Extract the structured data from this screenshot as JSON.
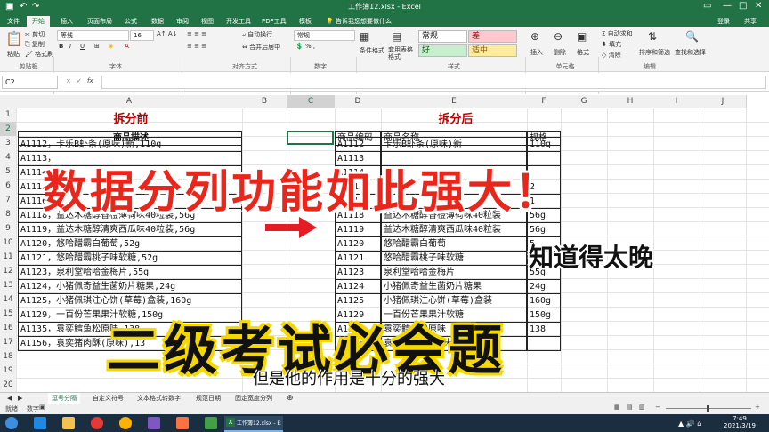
{
  "window": {
    "title": "工作簿12.xlsx - Excel",
    "login": "登录",
    "share": "共享",
    "tell_me": "告诉我您想要做什么"
  },
  "ribbon_tabs": [
    "文件",
    "开始",
    "插入",
    "页面布局",
    "公式",
    "数据",
    "审阅",
    "视图",
    "开发工具",
    "PDF工具",
    "模板"
  ],
  "ribbon": {
    "clipboard": {
      "label": "剪贴板",
      "paste": "粘贴",
      "cut": "剪切",
      "copy": "复制",
      "format_painter": "格式刷"
    },
    "font": {
      "label": "字体",
      "name": "等线",
      "size": "16"
    },
    "alignment": {
      "label": "对齐方式",
      "wrap": "自动换行",
      "merge": "合并后居中"
    },
    "number": {
      "label": "数字",
      "format": "常规"
    },
    "styles": {
      "conditional": "条件格式",
      "table": "套用表格格式",
      "normal": "常规",
      "bad": "差",
      "good": "好",
      "neutral": "适中",
      "label": "样式"
    },
    "cells": {
      "insert": "插入",
      "delete": "删除",
      "format": "格式",
      "label": "单元格"
    },
    "editing": {
      "autosum": "自动求和",
      "fill": "填充",
      "clear": "清除",
      "sort": "排序和筛选",
      "find": "查找和选择",
      "label": "编辑"
    }
  },
  "namebox": "C2",
  "formula_icons": {
    "cancel": "×",
    "enter": "✓",
    "fx": "fx"
  },
  "columns": [
    "A",
    "B",
    "C",
    "D",
    "E",
    "F",
    "G",
    "H",
    "I",
    "J"
  ],
  "rows": [
    "1",
    "2",
    "3",
    "4",
    "5",
    "6",
    "7",
    "8",
    "9",
    "10",
    "11",
    "12",
    "13",
    "14",
    "15",
    "16",
    "17",
    "18",
    "19",
    "20"
  ],
  "sheet": {
    "heading_before": "拆分前",
    "heading_after": "拆分后",
    "before_header": "商品描述",
    "before_rows": [
      "A1112，卡乐B虾条(原味)新,110g",
      "A1113，",
      "A1114，",
      "A1115，",
      "A1116，",
      "A1118，益达木糖醇香橙薄荷味40粒装,56g",
      "A1119，益达木糖醇清爽西瓜味40粒装,56g",
      "A1120，悠哈醋霸白葡萄,52g",
      "A1121，悠哈醋霸桃子味软糖,52g",
      "A1123，泉利堂哈哈金梅片,55g",
      "A1124，小猪佩奇益生菌奶片糖果,24g",
      "A1125，小猪佩琪注心饼(草莓)盒装,160g",
      "A1129，一百份芒果果汁软糖,150g",
      "A1135，袁奕鳕鱼松原味,138",
      "A1156，袁奕猪肉酥(原味),13"
    ],
    "after_headers": [
      "商品编码",
      "商品名称",
      "规格"
    ],
    "after_rows": [
      [
        "A1112",
        "卡乐B虾条(原味)新",
        "110g"
      ],
      [
        "A1113",
        "",
        ""
      ],
      [
        "A1114",
        "",
        ""
      ],
      [
        "A1115",
        "",
        "2"
      ],
      [
        "A1116",
        "",
        "1"
      ],
      [
        "A1118",
        "益达木糖醇香橙薄荷味40粒装",
        "56g"
      ],
      [
        "A1119",
        "益达木糖醇清爽西瓜味40粒装",
        "56g"
      ],
      [
        "A1120",
        "悠哈醋霸白葡萄",
        "5"
      ],
      [
        "A1121",
        "悠哈醋霸桃子味软糖",
        ""
      ],
      [
        "A1123",
        "泉利堂哈哈金梅片",
        "55g"
      ],
      [
        "A1124",
        "小猪佩奇益生菌奶片糖果",
        "24g"
      ],
      [
        "A1125",
        "小猪佩琪注心饼(草莓)盒装",
        "160g"
      ],
      [
        "A1129",
        "一百份芒果果汁软糖",
        "150g"
      ],
      [
        "A1135",
        "袁奕鳕鱼松原味",
        "138"
      ],
      [
        "A1156",
        "袁奕猪肉酥(原味)",
        ""
      ]
    ]
  },
  "overlays": {
    "headline": "数据分列功能如此强大！",
    "side_note": "知道得太晚",
    "banner": "二级考试必会题",
    "subtitle": "但是他的作用是十分的强大"
  },
  "sheet_tabs": [
    "逗号分隔",
    "自定义符号",
    "文本格式转数字",
    "规范日期",
    "固定宽度分列"
  ],
  "status": {
    "ready": "就绪",
    "mode": "数字"
  },
  "taskbar": {
    "time": "7:49",
    "date": "2021/3/19",
    "excel_window": "工作簿12.xlsx - Exc..."
  },
  "colors": {
    "excel_green": "#217346",
    "headline_red": "#e8261c",
    "heading_red": "#c00000",
    "arrow_red": "#e51c23"
  }
}
